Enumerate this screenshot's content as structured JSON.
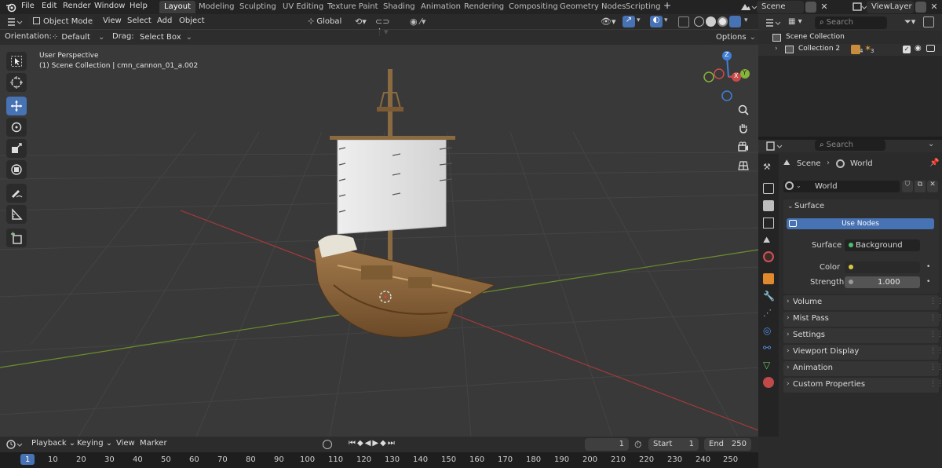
{
  "topbar": {
    "menus": [
      "File",
      "Edit",
      "Render",
      "Window",
      "Help"
    ],
    "workspaces": [
      "Layout",
      "Modeling",
      "Sculpting",
      "UV Editing",
      "Texture Paint",
      "Shading",
      "Animation",
      "Rendering",
      "Compositing",
      "Geometry Nodes",
      "Scripting"
    ],
    "active_workspace": "Layout",
    "add_tab": "+",
    "scene_field": "Scene",
    "viewlayer_field": "ViewLayer"
  },
  "viewport_header": {
    "mode": "Object Mode",
    "menus": [
      "View",
      "Select",
      "Add",
      "Object"
    ],
    "transform_orientation": "Global"
  },
  "tool_settings": {
    "orientation_label": "Orientation:",
    "orientation_value": "Default",
    "drag_label": "Drag:",
    "drag_value": "Select Box",
    "options": "Options"
  },
  "viewport_info": {
    "line1": "User Perspective",
    "line2": "(1) Scene Collection | cmn_cannon_01_a.002"
  },
  "gizmo": {
    "z": "Z",
    "x": "X",
    "y": "Y"
  },
  "outliner": {
    "search_placeholder": "Search",
    "root": "Scene Collection",
    "child": "Collection 2",
    "child_count_a": "4",
    "child_count_b": "3"
  },
  "properties": {
    "search_placeholder": "Search",
    "breadcrumb_scene": "Scene",
    "breadcrumb_world": "World",
    "world_name": "World",
    "surface_header": "Surface",
    "use_nodes": "Use Nodes",
    "surface_label": "Surface",
    "surface_value": "Background",
    "color_label": "Color",
    "strength_label": "Strength",
    "strength_value": "1.000",
    "panels": [
      "Volume",
      "Mist Pass",
      "Settings",
      "Viewport Display",
      "Animation",
      "Custom Properties"
    ]
  },
  "timeline": {
    "menus": [
      "Playback",
      "Keying",
      "View",
      "Marker"
    ],
    "current_frame": "1",
    "start_label": "Start",
    "start_value": "1",
    "end_label": "End",
    "end_value": "250",
    "ruler": [
      "1",
      "10",
      "20",
      "30",
      "40",
      "50",
      "60",
      "70",
      "80",
      "90",
      "100",
      "110",
      "120",
      "130",
      "140",
      "150",
      "160",
      "170",
      "180",
      "190",
      "200",
      "210",
      "220",
      "230",
      "240",
      "250"
    ]
  },
  "colors": {
    "accent": "#4772b3",
    "x_axis": "#c94a4a",
    "y_axis": "#86b33a",
    "z_axis": "#3f7fd6"
  }
}
